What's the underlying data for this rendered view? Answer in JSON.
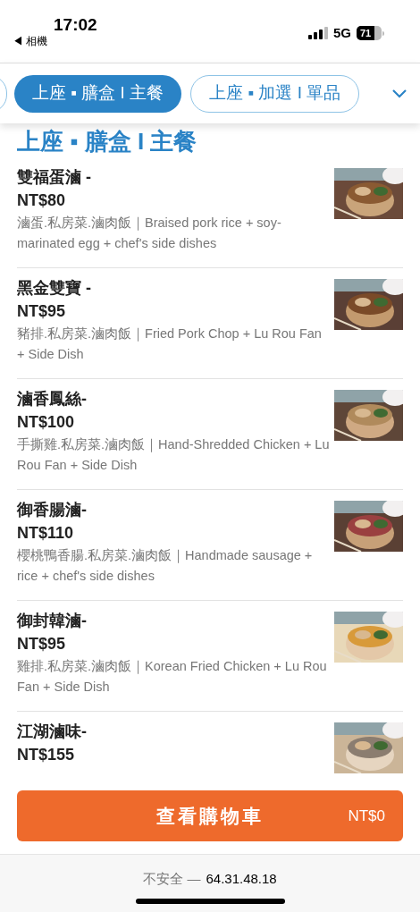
{
  "status_bar": {
    "time": "17:02",
    "back_label": "◀ 相機",
    "network": "5G",
    "battery": "71"
  },
  "tabs": [
    {
      "label": "上座 ▪ 膳盒 I 主餐",
      "selected": true
    },
    {
      "label": "上座 ▪ 加選 I 單品",
      "selected": false
    }
  ],
  "section_title": "上座 ▪ 膳盒 I 主餐",
  "items": [
    {
      "name": "雙福蛋滷 -",
      "price": "NT$80",
      "description": "滷蛋.私房菜.滷肉飯｜Braised pork rice + soy-marinated egg + chef's side dishes"
    },
    {
      "name": "黑金雙寶 -",
      "price": "NT$95",
      "description": "豬排.私房菜.滷肉飯｜Fried Pork Chop + Lu Rou Fan + Side Dish"
    },
    {
      "name": "滷香鳳絲-",
      "price": "NT$100",
      "description": "手撕雞.私房菜.滷肉飯｜Hand-Shredded Chicken + Lu Rou Fan + Side Dish"
    },
    {
      "name": "御香腸滷-",
      "price": "NT$110",
      "description": "櫻桃鴨香腸.私房菜.滷肉飯｜Handmade sausage + rice + chef's side dishes"
    },
    {
      "name": "御封韓滷-",
      "price": "NT$95",
      "description": "雞排.私房菜.滷肉飯｜Korean Fried Chicken + Lu Rou Fan + Side Dish"
    },
    {
      "name": "江湖滷味-",
      "price": "NT$155"
    }
  ],
  "cart_button": {
    "label": "查看購物車",
    "total": "NT$0"
  },
  "address_bar": {
    "security": "不安全 —",
    "host": "64.31.48.18"
  }
}
